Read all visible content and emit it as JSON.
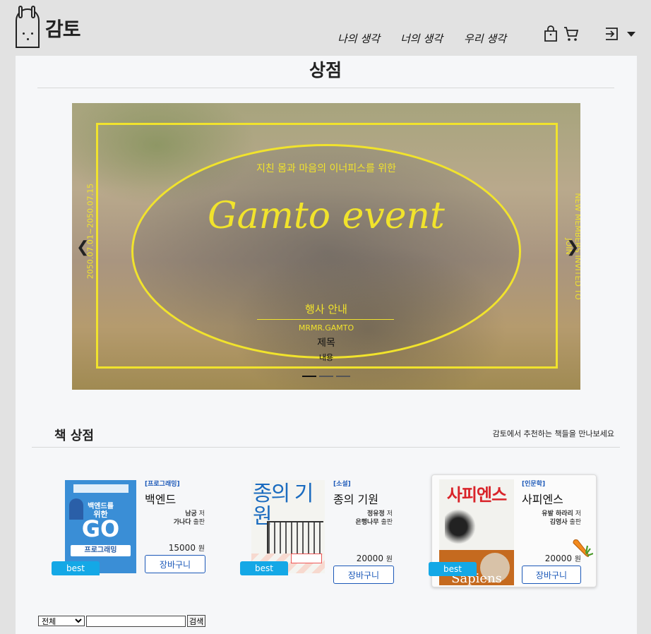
{
  "header": {
    "brand": "감토",
    "nav": [
      "나의 생각",
      "너의 생각",
      "우리 생각"
    ],
    "icons": [
      "bag-icon",
      "cart-icon",
      "login-icon",
      "caret-down-icon"
    ]
  },
  "page": {
    "title": "상점"
  },
  "banner": {
    "subtitle": "지친 몸과 마음의 이너피스를 위한",
    "script_title": "Gamto event",
    "side_left": "2050.07.01~2050.07.15",
    "side_right": "NEW MEMBERS INVITED TO JOIN",
    "event_label": "행사 안내",
    "signature": "MRMR.GAMTO",
    "name": "제목",
    "content": "내용",
    "slides": 3,
    "active_slide": 0,
    "accent": "#f1e32c"
  },
  "section": {
    "title": "책 상점",
    "desc": "감토에서 추천하는 책들을 만나보세요"
  },
  "books": [
    {
      "category": "[프로그래밍]",
      "name": "백엔드",
      "author": "남궁",
      "author_suffix": "저",
      "publisher": "가나다",
      "publisher_suffix": "출판",
      "price": "15000",
      "unit": "원",
      "cart": "장바구니",
      "badge": "best",
      "cover": {
        "line1": "백엔드를",
        "line2": "위한",
        "big": "GO",
        "line3": "프로그래밍"
      }
    },
    {
      "category": "[소설]",
      "name": "종의 기원",
      "author": "정유정",
      "author_suffix": "저",
      "publisher": "은행나무",
      "publisher_suffix": "출판",
      "price": "20000",
      "unit": "원",
      "cart": "장바구니",
      "badge": "best",
      "cover": {
        "big": "종의 기원"
      }
    },
    {
      "category": "[인문학]",
      "name": "사피엔스",
      "author": "유발 하라리",
      "author_suffix": "저",
      "publisher": "김영사",
      "publisher_suffix": "출판",
      "price": "20000",
      "unit": "원",
      "cart": "장바구니",
      "badge": "best",
      "cover": {
        "big": "사피엔스",
        "en": "Sapiens"
      }
    }
  ],
  "search": {
    "option": "전체",
    "button": "검색"
  }
}
